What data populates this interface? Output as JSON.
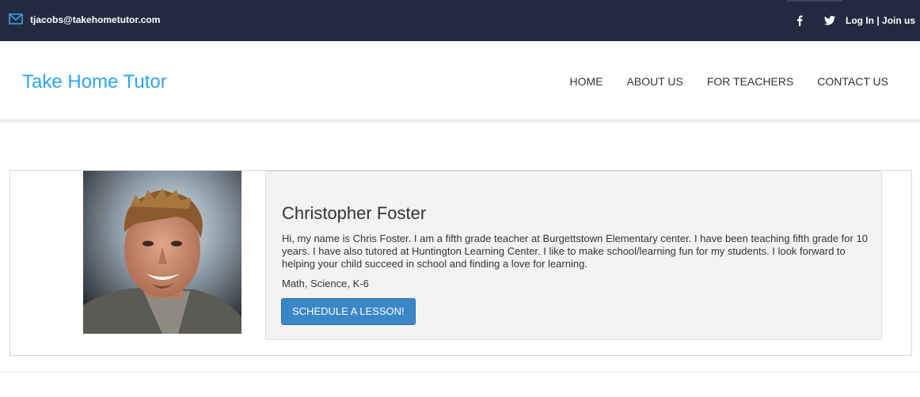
{
  "topbar": {
    "email": "tjacobs@takehometutor.com",
    "login_label": "Log In",
    "separator": "|",
    "join_label": "Join us",
    "icons": [
      "mail-icon",
      "facebook-icon",
      "twitter-icon"
    ],
    "background": "#212a40"
  },
  "header": {
    "brand": "Take Home Tutor",
    "brand_color": "#2ea3f2",
    "nav": [
      "HOME",
      "ABOUT US",
      "FOR TEACHERS",
      "CONTACT US"
    ]
  },
  "tutor": {
    "name": "Christopher Foster",
    "bio": "Hi, my name is Chris Foster. I am a fifth grade teacher at Burgettstown Elementary center. I have been teaching fifth grade for 10 years. I have also tutored at Huntington Learning Center. I like to make school/learning fun for my students. I look forward to helping your child succeed in school and finding a love for learning.",
    "subjects": "Math, Science, K-6",
    "cta": "SCHEDULE A LESSON!",
    "cta_color": "#3a87c8"
  }
}
